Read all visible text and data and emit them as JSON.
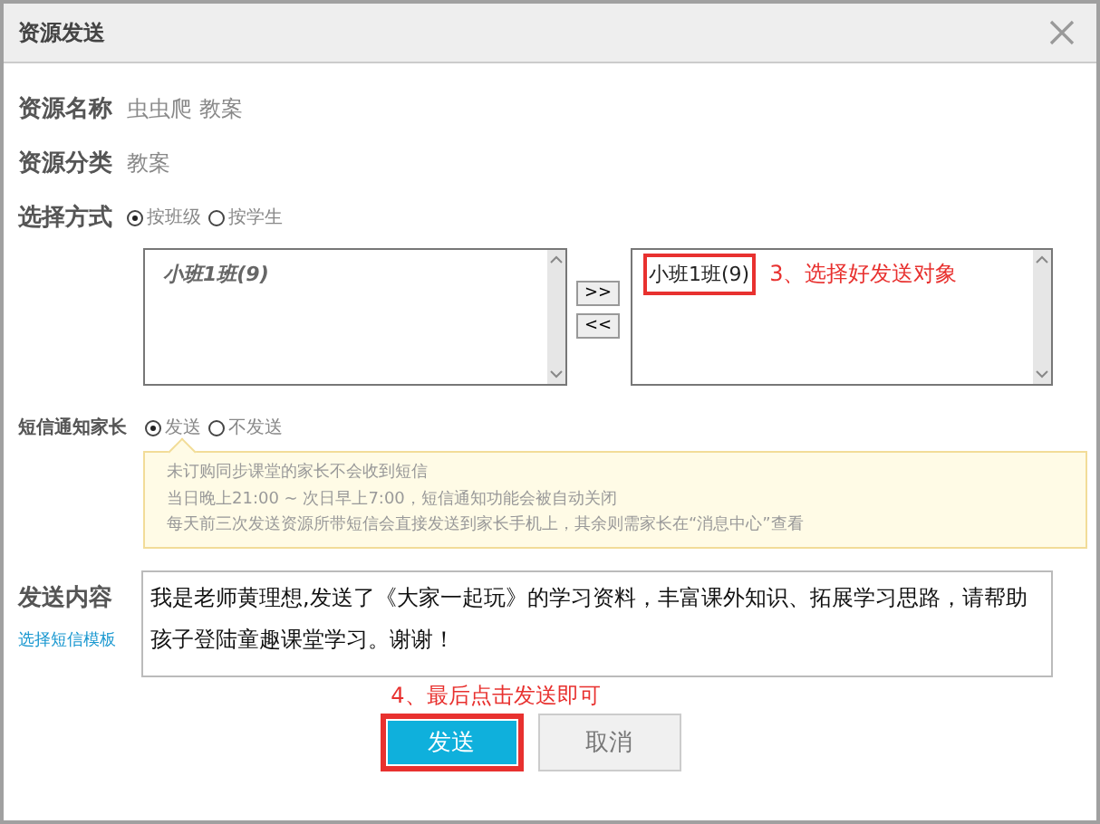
{
  "window": {
    "title": "资源发送"
  },
  "fields": [
    {
      "label": "资源名称",
      "value": "虫虫爬 教案"
    },
    {
      "label": "资源分类",
      "value": "教案"
    }
  ],
  "method": {
    "label": "选择方式",
    "options": [
      {
        "label": "按班级",
        "selected": true
      },
      {
        "label": "按学生",
        "selected": false
      }
    ]
  },
  "transfer": {
    "source": [
      {
        "label": "小班1班(9)"
      }
    ],
    "target": [
      {
        "label": "小班1班(9)",
        "annotated": true
      }
    ],
    "add": ">>",
    "remove": "<<",
    "annotation": "3、选择好发送对象"
  },
  "sms": {
    "label": "短信通知家长",
    "options": [
      {
        "label": "发送",
        "selected": true
      },
      {
        "label": "不发送",
        "selected": false
      }
    ],
    "notice": [
      "未订购同步课堂的家长不会收到短信",
      "当日晚上21:00 ~ 次日早上7:00，短信通知功能会被自动关闭",
      "每天前三次发送资源所带短信会直接发送到家长手机上，其余则需家长在“消息中心”查看"
    ]
  },
  "content": {
    "label": "发送内容",
    "link": "选择短信模板",
    "value": "我是老师黄理想,发送了《大家一起玩》的学习资料，丰富课外知识、拓展学习思路，请帮助孩子登陆童趣课堂学习。谢谢！",
    "annotation": "4、最后点击发送即可"
  },
  "buttons": [
    {
      "label": "发送",
      "kind": "primary",
      "annotated": true
    },
    {
      "label": "取消",
      "kind": "secondary",
      "annotated": false
    }
  ]
}
